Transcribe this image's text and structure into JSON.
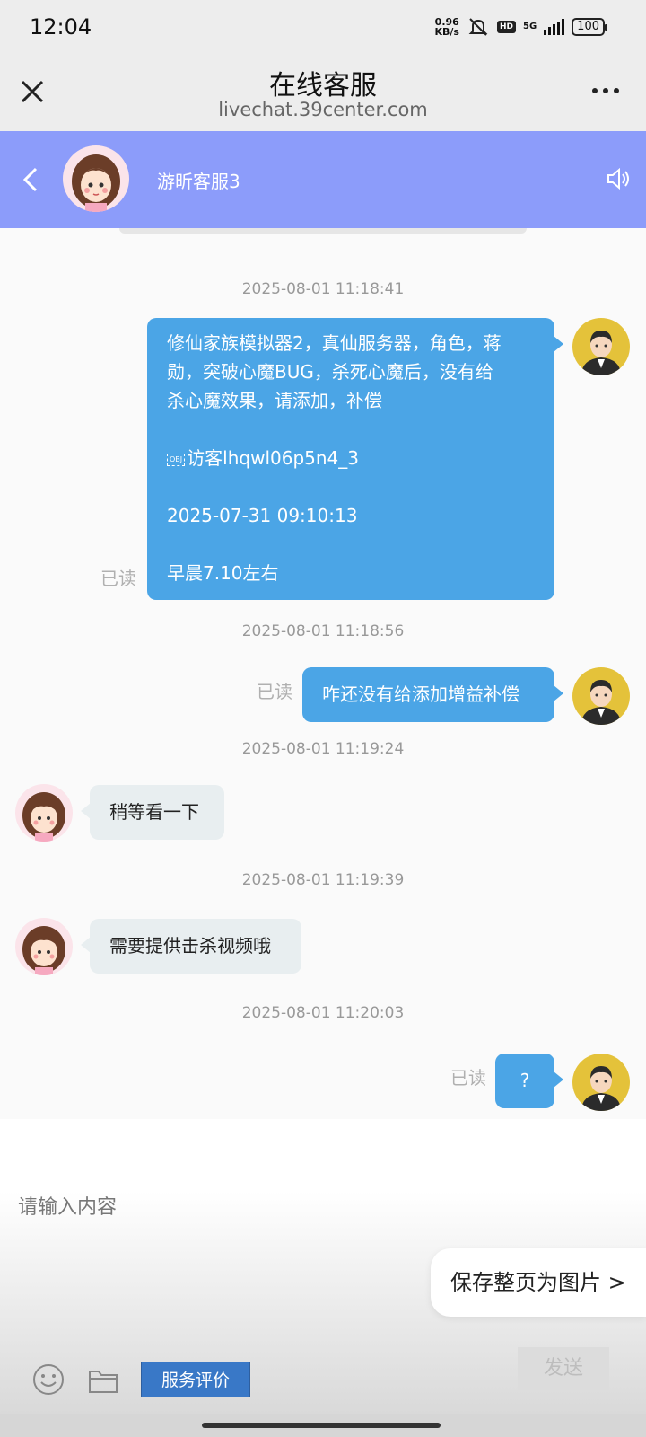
{
  "status_bar": {
    "time": "12:04",
    "speed_value": "0.96",
    "speed_unit": "KB/s",
    "hd": "HD",
    "network": "5G",
    "battery": "100"
  },
  "browser": {
    "title": "在线客服",
    "url": "livechat.39center.com"
  },
  "chat_header": {
    "agent_name": "游昕客服3",
    "color": "#8c9cfa"
  },
  "messages": [
    {
      "time": "2025-08-01 11:18:41",
      "side": "out",
      "paragraphs": [
        "修仙家族模拟器2，真仙服务器，角色，蒋",
        "勋，突破心魔BUG，杀死心魔后，没有给",
        "杀心魔效果，请添加，补偿",
        "",
        "访客lhqwl06p5n4_3",
        "",
        "2025-07-31 09:10:13",
        "",
        "早晨7.10左右"
      ],
      "obj_marker": "OBJ",
      "status": "已读"
    },
    {
      "time": "2025-08-01 11:18:56",
      "side": "out",
      "text": "咋还没有给添加增益补偿",
      "status": "已读"
    },
    {
      "time": "2025-08-01 11:19:24",
      "side": "in",
      "text": "稍等看一下"
    },
    {
      "time": "2025-08-01 11:19:39",
      "side": "in",
      "text": "需要提供击杀视频哦"
    },
    {
      "time": "2025-08-01 11:20:03",
      "side": "out",
      "text": "?",
      "status": "已读"
    }
  ],
  "input": {
    "placeholder": "请输入内容",
    "save_page": "保存整页为图片 >",
    "rate": "服务评价",
    "send": "发送"
  },
  "colors": {
    "bubble_out": "#4ba5e6",
    "bubble_in": "#e8eef0",
    "rate_button": "#3978c7"
  }
}
